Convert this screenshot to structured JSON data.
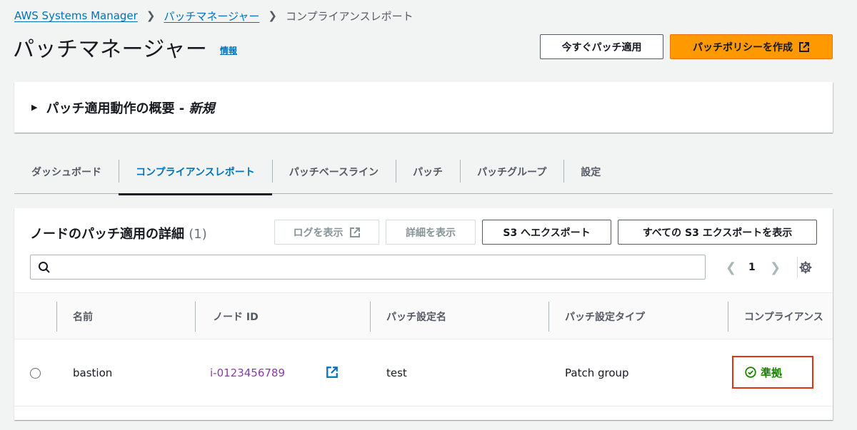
{
  "breadcrumb": {
    "items": [
      "AWS Systems Manager",
      "パッチマネージャー"
    ],
    "current": "コンプライアンスレポート"
  },
  "header": {
    "title": "パッチマネージャー",
    "info": "情報",
    "apply_now_label": "今すぐパッチ適用",
    "create_policy_label": "パッチポリシーを作成"
  },
  "overview_panel": {
    "title": "パッチ適用動作の概要 - ",
    "badge": "新規"
  },
  "tabs": [
    {
      "label": "ダッシュボード"
    },
    {
      "label": "コンプライアンスレポート"
    },
    {
      "label": "パッチベースライン"
    },
    {
      "label": "パッチ"
    },
    {
      "label": "パッチグループ"
    },
    {
      "label": "設定"
    }
  ],
  "table": {
    "title": "ノードのパッチ適用の詳細",
    "count": "(1)",
    "view_logs_label": "ログを表示",
    "view_details_label": "詳細を表示",
    "export_s3_label": "S3 へエクスポート",
    "view_all_exports_label": "すべての S3 エクスポートを表示",
    "search_placeholder": "",
    "page": "1",
    "columns": [
      "名前",
      "ノード ID",
      "パッチ設定名",
      "パッチ設定タイプ",
      "コンプライアンス"
    ],
    "rows": [
      {
        "name": "bastion",
        "node_id": "i-0123456789",
        "config_name": "test",
        "config_type": "Patch group",
        "compliance": "準拠"
      }
    ]
  },
  "colors": {
    "link": "#0073bb",
    "primary": "#ff9900",
    "visited_link": "#8a3ba3",
    "success": "#1d8102",
    "highlight": "#df3312"
  }
}
